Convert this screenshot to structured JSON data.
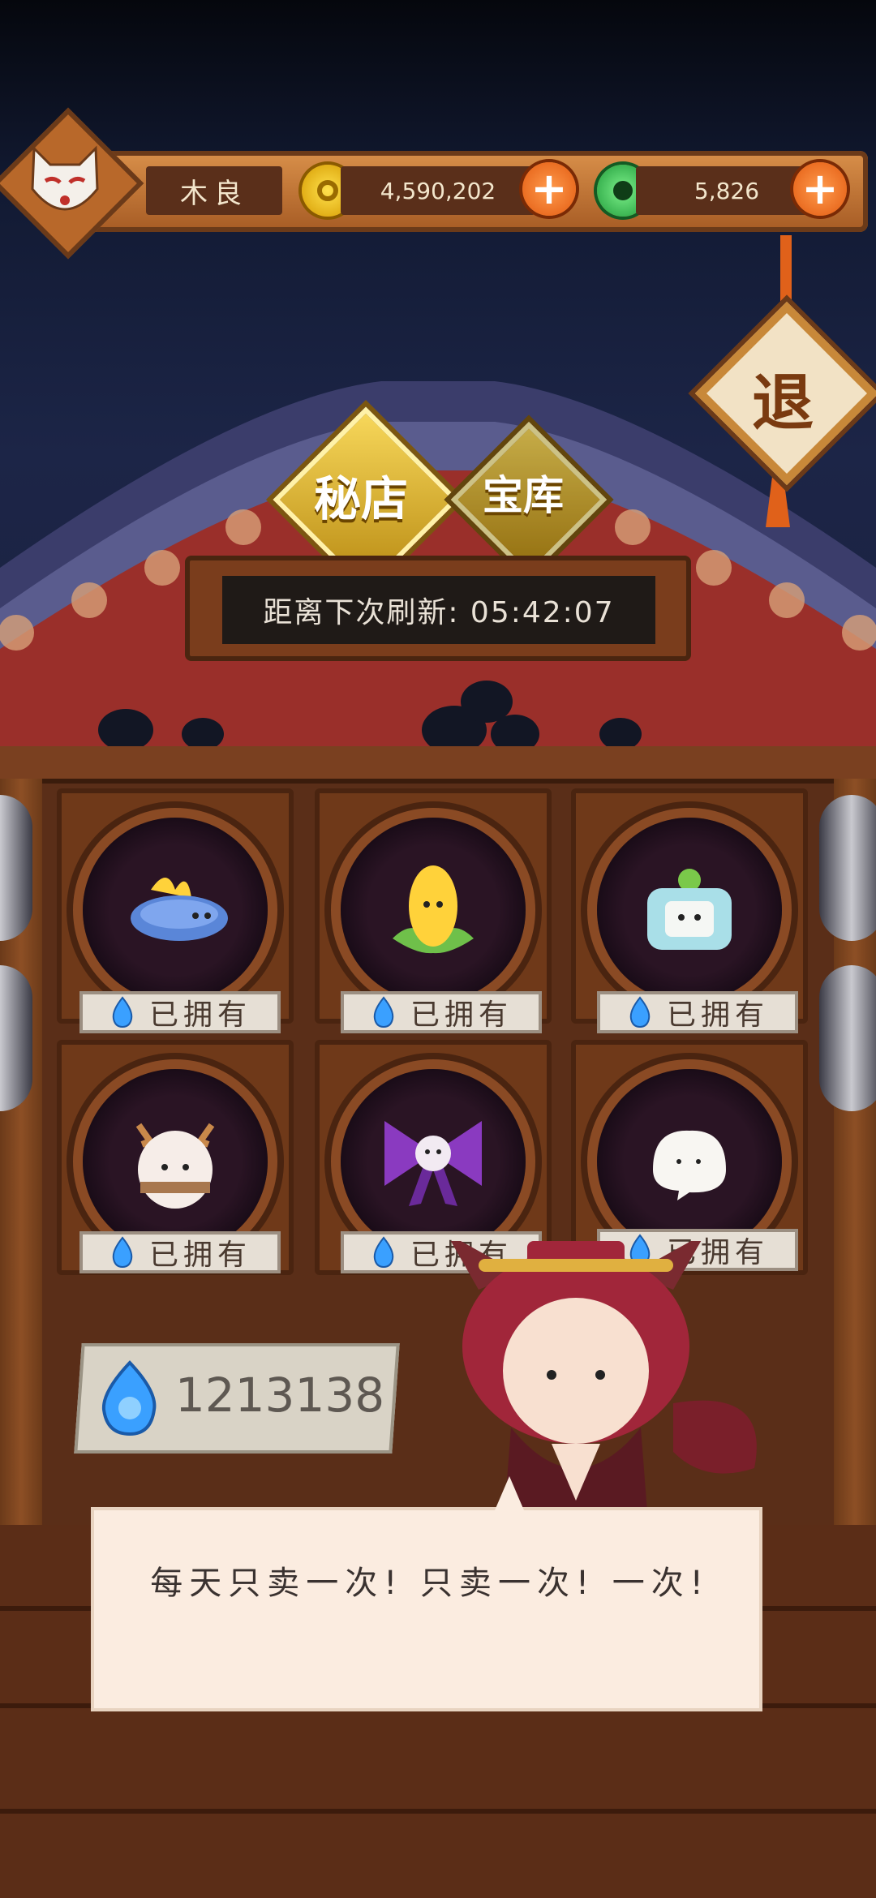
{
  "player": {
    "name": "木良"
  },
  "currency": {
    "gold": "4,590,202",
    "jade": "5,826",
    "soul_fire": "1213138"
  },
  "tabs": [
    {
      "label": "秘店",
      "active": true
    },
    {
      "label": "宝库",
      "active": false
    }
  ],
  "exit_label": "退",
  "refresh": {
    "label": "距离下次刷新: 05:42:07"
  },
  "shop_items": [
    {
      "name": "blue-sea-slug",
      "status": "已拥有"
    },
    {
      "name": "yellow-sprout",
      "status": "已拥有"
    },
    {
      "name": "tv-box-creature",
      "status": "已拥有"
    },
    {
      "name": "antler-egg",
      "status": "已拥有"
    },
    {
      "name": "purple-bow",
      "status": "已拥有"
    },
    {
      "name": "white-mochi",
      "status": "已拥有"
    }
  ],
  "dialog": {
    "text": "每天只卖一次! 只卖一次! 一次!"
  },
  "colors": {
    "gold": "#f7d75a",
    "wood": "#6f3919",
    "jade": "#1f9b3a",
    "plus": "#e25a10",
    "flame": "#3aa0ff"
  }
}
